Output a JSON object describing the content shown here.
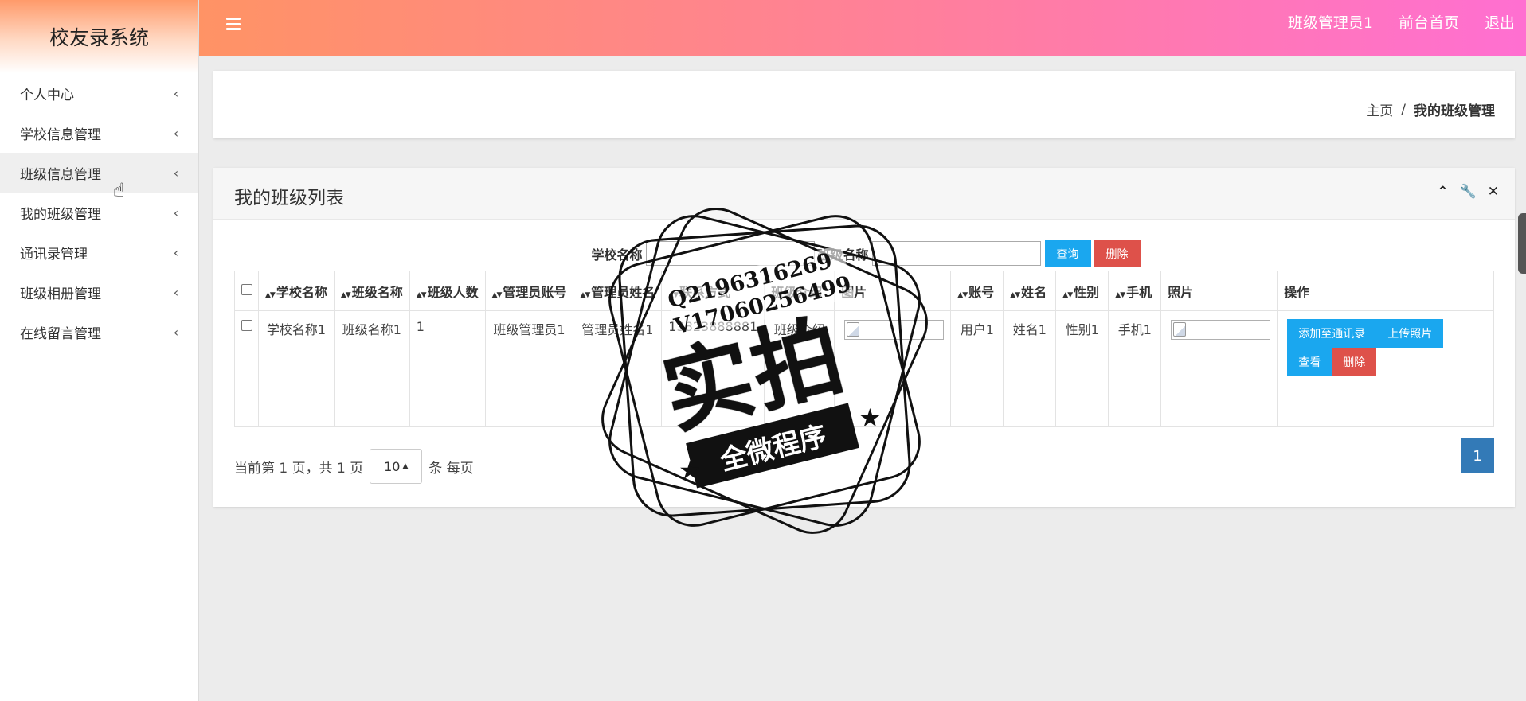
{
  "app": {
    "title": "校友录系统"
  },
  "sidebar": {
    "items": [
      {
        "label": "个人中心"
      },
      {
        "label": "学校信息管理"
      },
      {
        "label": "班级信息管理"
      },
      {
        "label": "我的班级管理"
      },
      {
        "label": "通讯录管理"
      },
      {
        "label": "班级相册管理"
      },
      {
        "label": "在线留言管理"
      }
    ],
    "active_index": 2,
    "chevron": "‹"
  },
  "header": {
    "user": "班级管理员1",
    "home_link": "前台首页",
    "logout": "退出",
    "gradient": [
      "#ff9365",
      "#ff6fd1"
    ]
  },
  "breadcrumb": {
    "home": "主页",
    "separator": "/",
    "current": "我的班级管理"
  },
  "panel": {
    "title": "我的班级列表"
  },
  "search": {
    "school_label": "学校名称",
    "school_value": "",
    "class_label": "班级名称",
    "class_value": "",
    "query_button": "查询",
    "delete_button": "删除"
  },
  "table": {
    "headers": [
      "学校名称",
      "班级名称",
      "班级人数",
      "管理员账号",
      "管理员姓名",
      "联系方式",
      "班级介绍",
      "图片",
      "账号",
      "姓名",
      "性别",
      "手机",
      "照片",
      "操作"
    ],
    "rows": [
      {
        "school": "学校名称1",
        "class": "班级名称1",
        "count": "1",
        "admin_account": "班级管理员1",
        "admin_name": "管理员姓名1",
        "contact": "13823888881",
        "intro": "班级介绍",
        "account": "用户1",
        "name": "姓名1",
        "gender": "性别1",
        "phone": "手机1",
        "actions": {
          "add_contacts": "添加至通讯录",
          "upload_photo": "上传照片",
          "view": "查看",
          "delete": "删除"
        }
      }
    ]
  },
  "pagination": {
    "summary": "当前第 1 页，共 1 页",
    "page_size": "10",
    "per_page": "条 每页",
    "current_page": "1"
  },
  "watermark": {
    "qq": "Q2196316269",
    "v": "V17060256499",
    "main": "实拍",
    "band": "全微程序"
  },
  "colors": {
    "primary": "#1aa7ef",
    "danger": "#de514a",
    "page": "#337ab7"
  }
}
